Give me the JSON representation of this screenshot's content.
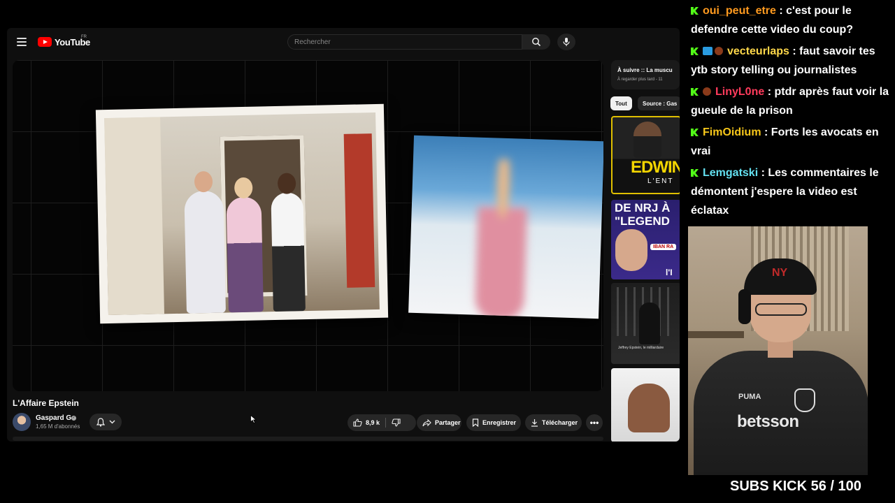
{
  "youtube": {
    "logo_text": "YouTube",
    "region": "FR",
    "search": {
      "placeholder": "Rechercher"
    },
    "video": {
      "title": "L'Affaire Epstein",
      "channel": "Gaspard G",
      "subscribers": "1,65 M d'abonnés",
      "likes": "8,9 k",
      "share_label": "Partager",
      "save_label": "Enregistrer",
      "download_label": "Télécharger",
      "more_label": "•••"
    },
    "sidebar": {
      "up_next_title": "À suivre :: La muscu",
      "up_next_sub": "À regarder plus tard - 11",
      "chips": [
        "Tout",
        "Source : Gas"
      ],
      "thumbnails": [
        {
          "text": "EDWIN",
          "sub": "L'ENT"
        },
        {
          "text": "DE NRJ À\n\"LEGEND",
          "badge": "IBAN RA",
          "tail": "l'I"
        },
        {
          "caption": "Jeffrey Epstein, le milliardaire"
        },
        {}
      ]
    }
  },
  "chat": {
    "messages": [
      {
        "user": "oui_peut_etre",
        "text": ": c'est pour le defendre cette video du coup?"
      },
      {
        "user": "vecteurlaps",
        "text": ": faut savoir tes ytb story telling ou journalistes"
      },
      {
        "user": "LinyL0ne",
        "text": ": ptdr après faut voir la gueule de la prison"
      },
      {
        "user": "FimOidium",
        "text": ": Forts les avocats en vrai"
      },
      {
        "user": "Lemgatski",
        "text": ": Les commentaires le démontent j'espere la video est éclatax"
      }
    ]
  },
  "webcam": {
    "jersey_brand": "betsson",
    "jersey_maker": "PUMA",
    "cap_logo": "NY"
  },
  "overlay": {
    "subs_goal": "SUBS KICK 56 / 100"
  },
  "colors": {
    "kick_green": "#53fc18",
    "youtube_red": "#ff0000"
  }
}
